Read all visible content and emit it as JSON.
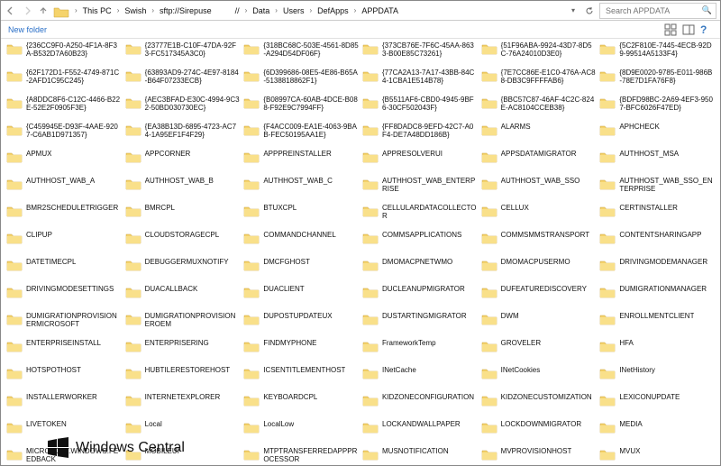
{
  "nav": {
    "back": "‹",
    "fwd": "›",
    "up": "↑",
    "refresh": "⟳"
  },
  "breadcrumbs": [
    "This PC",
    "Swish",
    "sftp://Sirepuse",
    "//",
    "Data",
    "Users",
    "DefApps",
    "APPDATA"
  ],
  "search_placeholder": "Search APPDATA",
  "toolbar": {
    "newfolder": "New folder"
  },
  "folders": [
    "{236CC9F0-A250-4F1A-8F3A-B532D7A60B23}",
    "{23777E1B-C10F-47DA-92F3-FC517345A3C0}",
    "{318BC68C-503E-4561-8D85-A294D54DF06F}",
    "{373CB76E-7F6C-45AA-8633-B00E85C73261}",
    "{51F96ABA-9924-43D7-8D5C-76A24010D3E0}",
    "{5C2F810E-7445-4ECB-92D9-99514A5133F4}",
    "{62F172D1-F552-4749-871C-2AFD1C95C245}",
    "{63893AD9-274C-4E97-8184-B64F07233ECB}",
    "{6D399686-08E5-4E86-B65A-5138818862F1}",
    "{77CA2A13-7A17-43BB-84C4-1CBA1E514B78}",
    "{7E7CC86E-E1C0-476A-AC88-DB3C9FFFFAB6}",
    "{8D9E0020-9785-E011-986B-78E7D1FA76F8}",
    "{A8DDC8F6-C12C-4466-B22E-52E2F0905F3E}",
    "{AEC3BFAD-E30C-4994-9C32-50BD030730EC}",
    "{B08997CA-60AB-4DCE-B088-F92E9C7994FF}",
    "{B5511AF6-CBD0-4945-9BF6-30CF502043F}",
    "{BBC57C87-46AF-4C2C-824E-AC8104CCEB38}",
    "{BDFD98BC-2A69-4EF3-9507-BFC6026F47ED}",
    "{C459945E-D93F-4AAE-9207-C6AB1D971357}",
    "{EA38B13D-6895-4723-AC74-1A95EF1F4F29}",
    "{F4ACC009-EA1E-4063-9BAB-FEC50195AA1E}",
    "{FF8DADC8-9EFD-42C7-A0F4-DE7A48DD186B}",
    "ALARMS",
    "APHCHECK",
    "APMUX",
    "APPCORNER",
    "APPPREINSTALLER",
    "APPRESOLVERUI",
    "APPSDATAMIGRATOR",
    "AUTHHOST_MSA",
    "AUTHHOST_WAB_A",
    "AUTHHOST_WAB_B",
    "AUTHHOST_WAB_C",
    "AUTHHOST_WAB_ENTERPRISE",
    "AUTHHOST_WAB_SSO",
    "AUTHHOST_WAB_SSO_ENTERPRISE",
    "BMR2SCHEDULETRIGGER",
    "BMRCPL",
    "BTUXCPL",
    "CELLULARDATACOLLECTOR",
    "CELLUX",
    "CERTINSTALLER",
    "CLIPUP",
    "CLOUDSTORAGECPL",
    "COMMANDCHANNEL",
    "COMMSAPPLICATIONS",
    "COMMSMMSTRANSPORT",
    "CONTENTSHARINGAPP",
    "DATETIMECPL",
    "DEBUGGERMUXNOTIFY",
    "DMCFGHOST",
    "DMOMACPNETWMO",
    "DMOMACPUSERMO",
    "DRIVINGMODEMANAGER",
    "DRIVINGMODESETTINGS",
    "DUACALLBACK",
    "DUACLIENT",
    "DUCLEANUPMIGRATOR",
    "DUFEATUREDISCOVERY",
    "DUMIGRATIONMANAGER",
    "DUMIGRATIONPROVISIONERMICROSOFT",
    "DUMIGRATIONPROVISIONEROEM",
    "DUPOSTUPDATEUX",
    "DUSTARTINGMIGRATOR",
    "DWM",
    "ENROLLMENTCLIENT",
    "ENTERPRISEINSTALL",
    "ENTERPRISERING",
    "FINDMYPHONE",
    "FrameworkTemp",
    "GROVELER",
    "HFA",
    "HOTSPOTHOST",
    "HUBTILERESTOREHOST",
    "ICSENTITLEMENTHOST",
    "INetCache",
    "INetCookies",
    "INetHistory",
    "INSTALLERWORKER",
    "INTERNETEXPLORER",
    "KEYBOARDCPL",
    "KIDZONECONFIGURATION",
    "KIDZONECUSTOMIZATION",
    "LEXICONUPDATE",
    "LIVETOKEN",
    "Local",
    "LocalLow",
    "LOCKANDWALLPAPER",
    "LOCKDOWNMIGRATOR",
    "MEDIA",
    "MICROSOFT.WINDOWS.FEEDBACK",
    "MOBILEUI",
    "MTPTRANSFERREDAPPPROCESSOR",
    "MUSNOTIFICATION",
    "MVPROVISIONHOST",
    "MVUX"
  ],
  "watermark": "Windows Central"
}
